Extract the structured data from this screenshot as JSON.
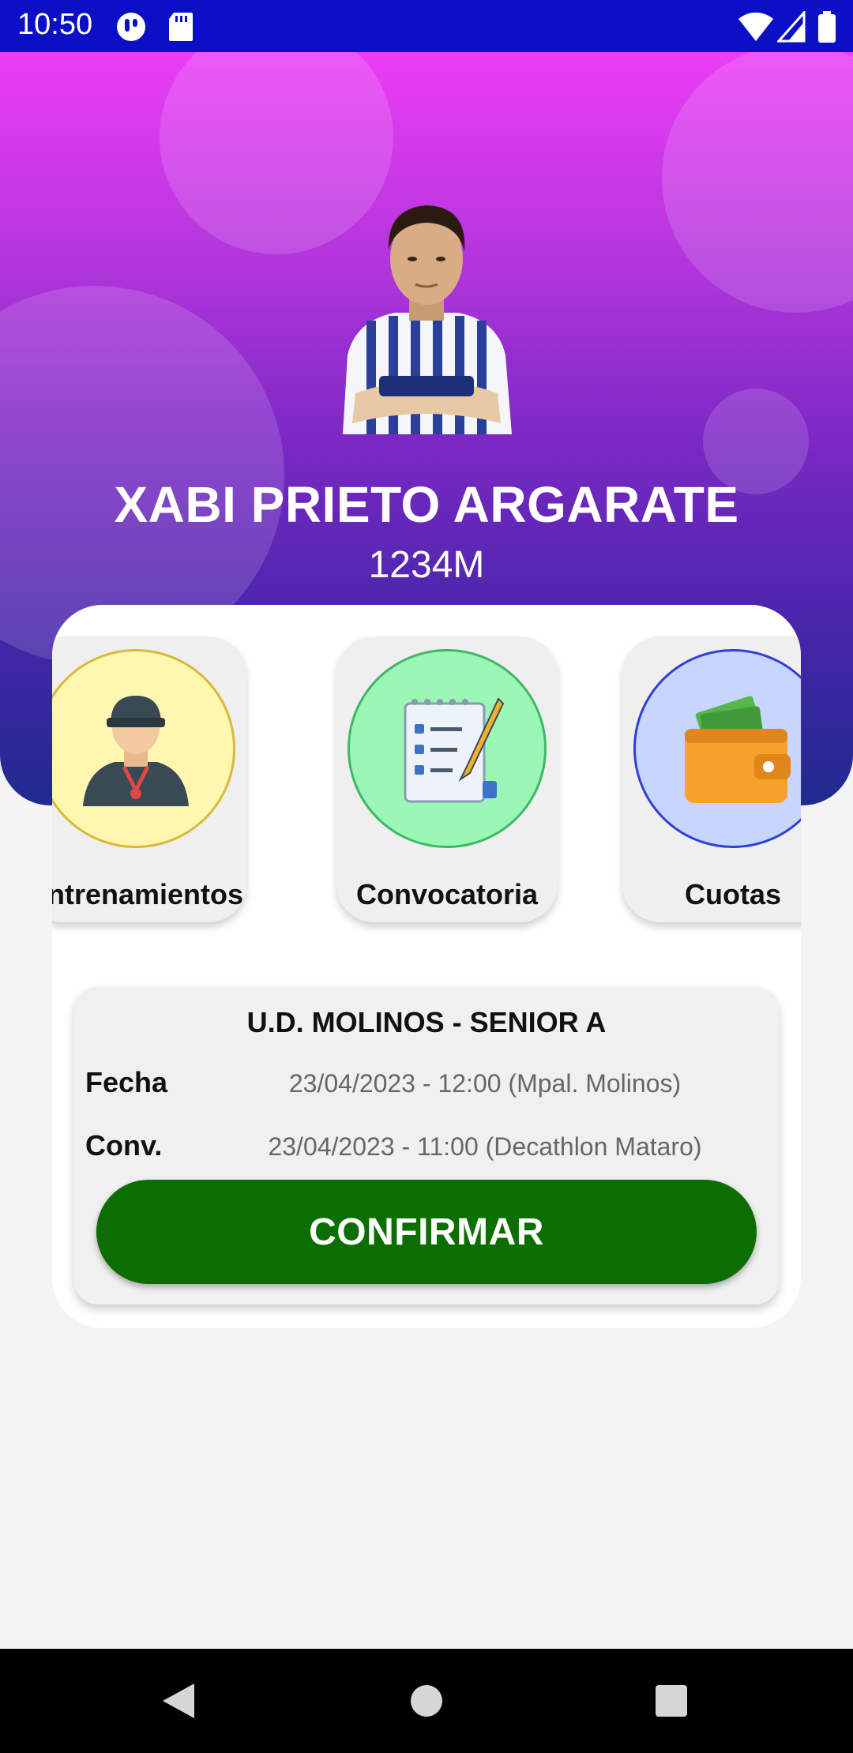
{
  "status_bar": {
    "time": "10:50"
  },
  "profile": {
    "name": "XABI PRIETO ARGARATE",
    "id": "1234M",
    "avatar_icon": "player-photo"
  },
  "menu": [
    {
      "label": "Entrenamientos",
      "icon": "coach-whistle-icon",
      "bg": "#fff6b0",
      "border": "#d8b93a"
    },
    {
      "label": "Convocatoria",
      "icon": "checklist-icon",
      "bg": "#9af7b6",
      "border": "#3fb865"
    },
    {
      "label": "Cuotas",
      "icon": "wallet-icon",
      "bg": "#c6d6ff",
      "border": "#2f3fd8"
    }
  ],
  "match": {
    "title": "U.D. MOLINOS - SENIOR A",
    "fecha_label": "Fecha",
    "fecha_value": "23/04/2023 - 12:00 (Mpal. Molinos)",
    "conv_label": "Conv.",
    "conv_value": "23/04/2023 - 11:00 (Decathlon Mataro)",
    "confirm_label": "CONFIRMAR"
  },
  "colors": {
    "primary_gradient_top": "#ec3cf6",
    "primary_gradient_bottom": "#1f2a8e",
    "confirm": "#0c6e00"
  }
}
